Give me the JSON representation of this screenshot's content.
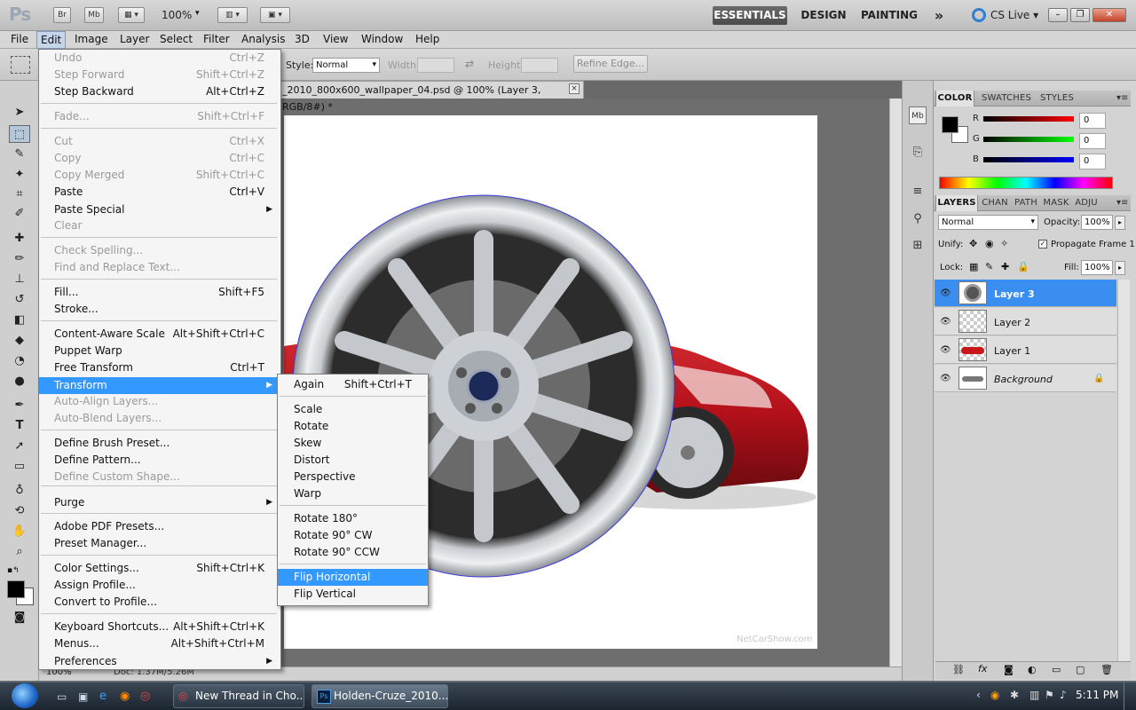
{
  "appbar": {
    "bridge_label": "Br",
    "minibridge_label": "Mb",
    "zoom": "100%",
    "workspaces": [
      "ESSENTIALS",
      "DESIGN",
      "PAINTING"
    ],
    "more_glyph": "»",
    "cslive": "CS Live"
  },
  "menubar": [
    "File",
    "Edit",
    "Image",
    "Layer",
    "Select",
    "Filter",
    "Analysis",
    "3D",
    "View",
    "Window",
    "Help"
  ],
  "options": {
    "style_label": "Style:",
    "style_value": "Normal",
    "width_label": "Width:",
    "height_label": "Height:",
    "refine_edge": "Refine Edge..."
  },
  "document": {
    "tab_title": "_2010_800x600_wallpaper_04.psd @ 100% (Layer 3, RGB/8#) *",
    "close_glyph": "×",
    "watermark": "NetCarShow.com",
    "status_zoom": "100%",
    "status_doc": "Doc: 1.37M/5.26M"
  },
  "edit_menu": [
    {
      "label": "Undo",
      "shortcut": "Ctrl+Z",
      "disabled": true
    },
    {
      "label": "Step Forward",
      "shortcut": "Shift+Ctrl+Z",
      "disabled": true
    },
    {
      "label": "Step Backward",
      "shortcut": "Alt+Ctrl+Z",
      "disabled": false
    },
    {
      "label": "Fade...",
      "shortcut": "Shift+Ctrl+F",
      "disabled": true
    },
    {
      "label": "Cut",
      "shortcut": "Ctrl+X",
      "disabled": true
    },
    {
      "label": "Copy",
      "shortcut": "Ctrl+C",
      "disabled": true
    },
    {
      "label": "Copy Merged",
      "shortcut": "Shift+Ctrl+C",
      "disabled": true
    },
    {
      "label": "Paste",
      "shortcut": "Ctrl+V",
      "disabled": false
    },
    {
      "label": "Paste Special",
      "shortcut": "",
      "disabled": false
    },
    {
      "label": "Clear",
      "shortcut": "",
      "disabled": true
    },
    {
      "label": "Check Spelling...",
      "shortcut": "",
      "disabled": true
    },
    {
      "label": "Find and Replace Text...",
      "shortcut": "",
      "disabled": true
    },
    {
      "label": "Fill...",
      "shortcut": "Shift+F5",
      "disabled": false
    },
    {
      "label": "Stroke...",
      "shortcut": "",
      "disabled": false
    },
    {
      "label": "Content-Aware Scale",
      "shortcut": "Alt+Shift+Ctrl+C",
      "disabled": false
    },
    {
      "label": "Puppet Warp",
      "shortcut": "",
      "disabled": false
    },
    {
      "label": "Free Transform",
      "shortcut": "Ctrl+T",
      "disabled": false
    },
    {
      "label": "Transform",
      "shortcut": "",
      "disabled": false
    },
    {
      "label": "Auto-Align Layers...",
      "shortcut": "",
      "disabled": true
    },
    {
      "label": "Auto-Blend Layers...",
      "shortcut": "",
      "disabled": true
    },
    {
      "label": "Define Brush Preset...",
      "shortcut": "",
      "disabled": false
    },
    {
      "label": "Define Pattern...",
      "shortcut": "",
      "disabled": false
    },
    {
      "label": "Define Custom Shape...",
      "shortcut": "",
      "disabled": true
    },
    {
      "label": "Purge",
      "shortcut": "",
      "disabled": false
    },
    {
      "label": "Adobe PDF Presets...",
      "shortcut": "",
      "disabled": false
    },
    {
      "label": "Preset Manager...",
      "shortcut": "",
      "disabled": false
    },
    {
      "label": "Color Settings...",
      "shortcut": "Shift+Ctrl+K",
      "disabled": false
    },
    {
      "label": "Assign Profile...",
      "shortcut": "",
      "disabled": false
    },
    {
      "label": "Convert to Profile...",
      "shortcut": "",
      "disabled": false
    },
    {
      "label": "Keyboard Shortcuts...",
      "shortcut": "Alt+Shift+Ctrl+K",
      "disabled": false
    },
    {
      "label": "Menus...",
      "shortcut": "Alt+Shift+Ctrl+M",
      "disabled": false
    },
    {
      "label": "Preferences",
      "shortcut": "",
      "disabled": false
    }
  ],
  "transform_menu": [
    {
      "label": "Again",
      "shortcut": "Shift+Ctrl+T"
    },
    {
      "label": "Scale",
      "shortcut": ""
    },
    {
      "label": "Rotate",
      "shortcut": ""
    },
    {
      "label": "Skew",
      "shortcut": ""
    },
    {
      "label": "Distort",
      "shortcut": ""
    },
    {
      "label": "Perspective",
      "shortcut": ""
    },
    {
      "label": "Warp",
      "shortcut": ""
    },
    {
      "label": "Rotate 180°",
      "shortcut": ""
    },
    {
      "label": "Rotate 90° CW",
      "shortcut": ""
    },
    {
      "label": "Rotate 90° CCW",
      "shortcut": ""
    },
    {
      "label": "Flip Horizontal",
      "shortcut": ""
    },
    {
      "label": "Flip Vertical",
      "shortcut": ""
    }
  ],
  "color_panel": {
    "tabs": [
      "COLOR",
      "SWATCHES",
      "STYLES"
    ],
    "r_label": "R",
    "g_label": "G",
    "b_label": "B",
    "r_value": "0",
    "g_value": "0",
    "b_value": "0"
  },
  "layers_panel": {
    "tabs": [
      "LAYERS",
      "CHAN",
      "PATH",
      "MASK",
      "ADJU"
    ],
    "blend_mode": "Normal",
    "opacity_label": "Opacity:",
    "opacity_value": "100%",
    "unify_label": "Unify:",
    "propagate_label": "Propagate Frame 1",
    "lock_label": "Lock:",
    "fill_label": "Fill:",
    "fill_value": "100%",
    "layers": [
      {
        "name": "Layer 3",
        "active": true
      },
      {
        "name": "Layer 2",
        "active": false
      },
      {
        "name": "Layer 1",
        "active": false
      },
      {
        "name": "Background",
        "active": false
      }
    ]
  },
  "taskbar": {
    "buttons": [
      "New Thread in Cho...",
      "Holden-Cruze_2010..."
    ],
    "clock": "5:11 PM"
  },
  "colors": {
    "highlight": "#3399ff",
    "active_layer": "#3a8ef0",
    "car_red": "#c8161a"
  }
}
